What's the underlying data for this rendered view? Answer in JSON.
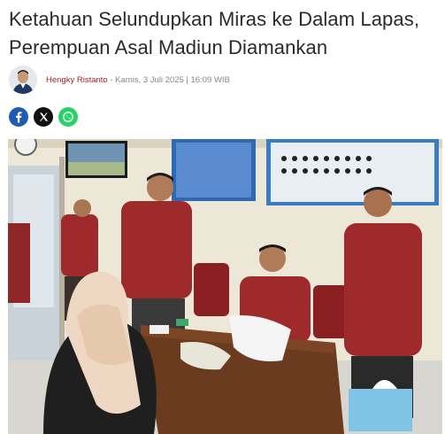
{
  "article": {
    "title": "Ketahuan Selundupkan Miras ke Dalam Lapas, Perempuan Asal Madiun Diamankan",
    "author": "Hengky Ristanto",
    "separator": " - ",
    "date": "Kamis, 3 Juli 2025 | 16:09 WIB"
  },
  "share": {
    "items": [
      {
        "name": "facebook",
        "glyph": "f",
        "color": "#1f5bb4"
      },
      {
        "name": "x",
        "glyph": "𝕏",
        "color": "#111111"
      },
      {
        "name": "whatsapp",
        "glyph": "✆",
        "color": "#25d366"
      }
    ]
  },
  "photo": {
    "subject": "Petugas lapas menginterogasi perempuan berkerudung di meja kayu"
  },
  "colors": {
    "author_link": "#a3222a",
    "uniform": "#9e2a2b",
    "wall": "#ece7d6"
  }
}
